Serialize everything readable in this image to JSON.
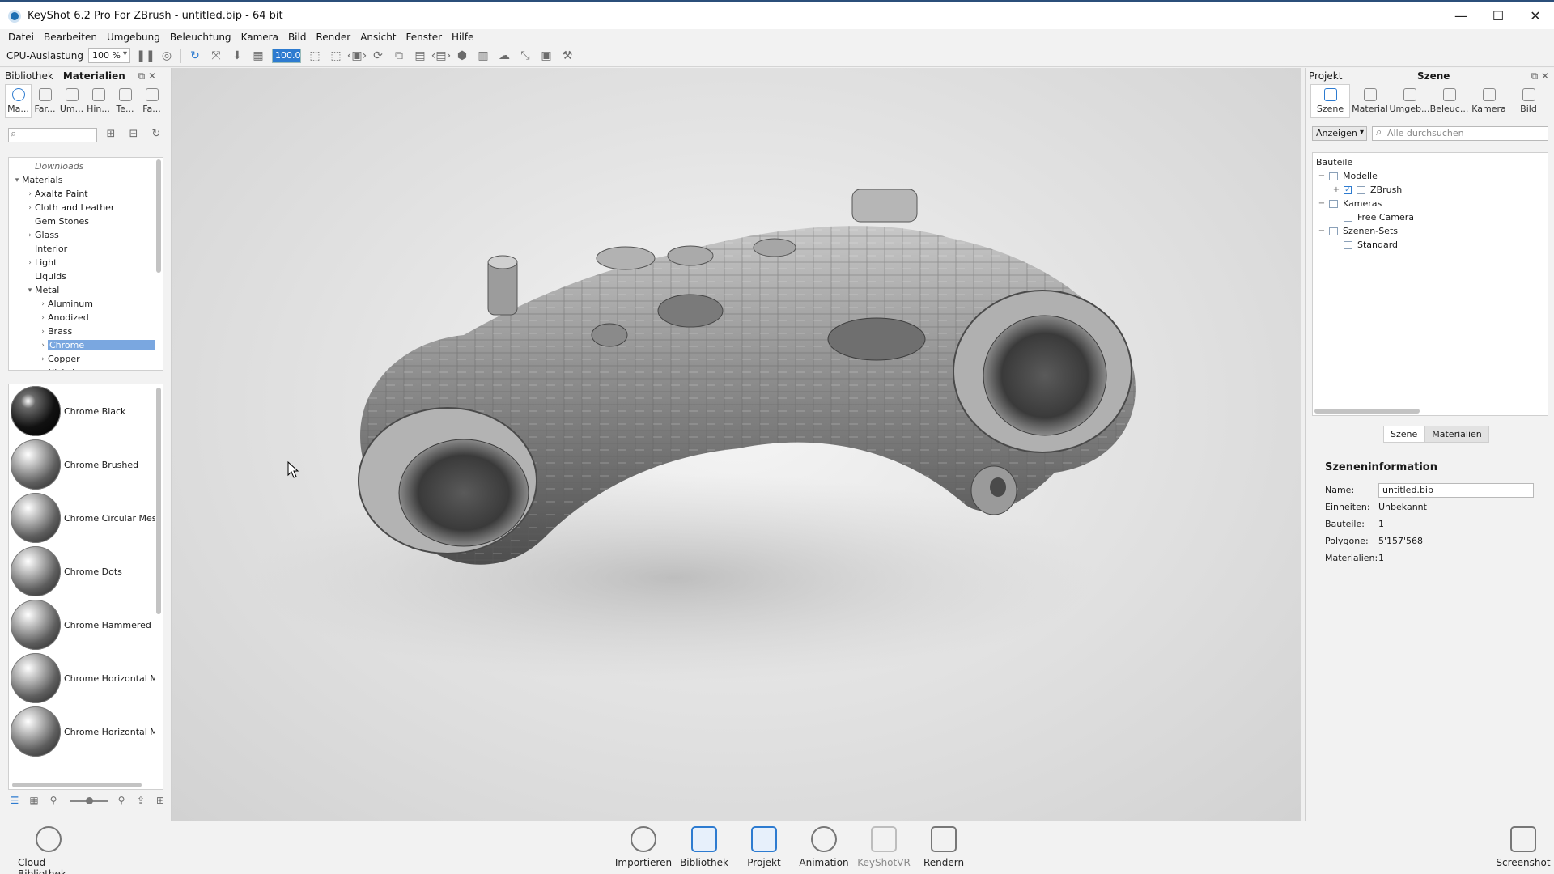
{
  "window": {
    "title": "KeyShot 6.2 Pro For ZBrush - untitled.bip - 64 bit",
    "minimize": "—",
    "maximize": "☐",
    "close": "✕"
  },
  "menu": [
    "Datei",
    "Bearbeiten",
    "Umgebung",
    "Beleuchtung",
    "Kamera",
    "Bild",
    "Render",
    "Ansicht",
    "Fenster",
    "Hilfe"
  ],
  "toolbar": {
    "cpu_label": "CPU-Auslastung",
    "cpu_value": "100 %",
    "field_value": "100.0"
  },
  "library": {
    "tab_library": "Bibliothek",
    "tab_materials": "Materialien",
    "category_tabs": [
      "Ma...",
      "Far...",
      "Um...",
      "Hin...",
      "Te...",
      "Fa..."
    ],
    "tree": [
      {
        "label": "Downloads",
        "indent": 1,
        "arrow": "",
        "style": "italic"
      },
      {
        "label": "Materials",
        "indent": 0,
        "arrow": "▾"
      },
      {
        "label": "Axalta Paint",
        "indent": 1,
        "arrow": "›"
      },
      {
        "label": "Cloth and Leather",
        "indent": 1,
        "arrow": "›"
      },
      {
        "label": "Gem Stones",
        "indent": 1,
        "arrow": ""
      },
      {
        "label": "Glass",
        "indent": 1,
        "arrow": "›"
      },
      {
        "label": "Interior",
        "indent": 1,
        "arrow": ""
      },
      {
        "label": "Light",
        "indent": 1,
        "arrow": "›"
      },
      {
        "label": "Liquids",
        "indent": 1,
        "arrow": ""
      },
      {
        "label": "Metal",
        "indent": 1,
        "arrow": "▾"
      },
      {
        "label": "Aluminum",
        "indent": 2,
        "arrow": "›"
      },
      {
        "label": "Anodized",
        "indent": 2,
        "arrow": "›"
      },
      {
        "label": "Brass",
        "indent": 2,
        "arrow": "›"
      },
      {
        "label": "Chrome",
        "indent": 2,
        "arrow": "›",
        "selected": true
      },
      {
        "label": "Copper",
        "indent": 2,
        "arrow": "›"
      },
      {
        "label": "Nickel",
        "indent": 2,
        "arrow": "›"
      }
    ],
    "materials": [
      "Chrome Black",
      "Chrome Brushed",
      "Chrome Circular Mesh",
      "Chrome Dots",
      "Chrome Hammered",
      "Chrome Horizontal Me",
      "Chrome Horizontal Me"
    ]
  },
  "project": {
    "panel_title": "Projekt",
    "panel_center": "Szene",
    "tabs": [
      "Szene",
      "Material",
      "Umgeb...",
      "Beleuc...",
      "Kamera",
      "Bild"
    ],
    "filter_label": "Anzeigen",
    "search_placeholder": "Alle durchsuchen",
    "tree_header": "Bauteile",
    "tree": [
      {
        "label": "Modelle",
        "pm": "−",
        "indent": 0,
        "kind": "icon"
      },
      {
        "label": "ZBrush",
        "pm": "+",
        "indent": 1,
        "kind": "check"
      },
      {
        "label": "Kameras",
        "pm": "−",
        "indent": 0,
        "kind": "icon"
      },
      {
        "label": "Free Camera",
        "pm": "",
        "indent": 1,
        "kind": "icon"
      },
      {
        "label": "Szenen-Sets",
        "pm": "−",
        "indent": 0,
        "kind": "icon"
      },
      {
        "label": "Standard",
        "pm": "",
        "indent": 1,
        "kind": "icon"
      }
    ],
    "subtab_scene": "Szene",
    "subtab_materials": "Materialien",
    "info_title": "Szeneninformation",
    "name_label": "Name:",
    "name_value": "untitled.bip",
    "units_label": "Einheiten:",
    "units_value": "Unbekannt",
    "parts_label": "Bauteile:",
    "parts_value": "1",
    "polys_label": "Polygone:",
    "polys_value": "5'157'568",
    "mats_label": "Materialien:",
    "mats_value": "1"
  },
  "dock": {
    "cloud": "Cloud-Bibliothek",
    "importieren": "Importieren",
    "bibliothek": "Bibliothek",
    "projekt": "Projekt",
    "animation": "Animation",
    "keyshotvr": "KeyShotVR",
    "rendern": "Rendern",
    "screenshot": "Screenshot"
  }
}
